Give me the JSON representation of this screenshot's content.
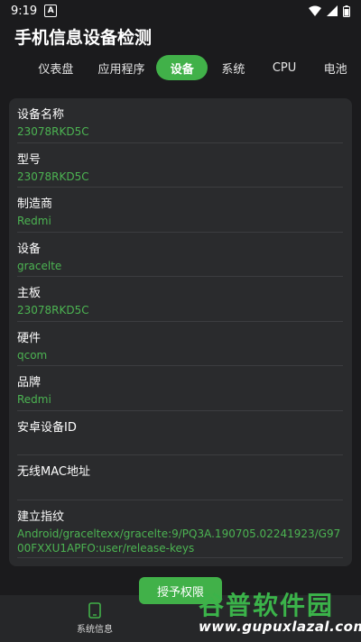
{
  "status_bar": {
    "time": "9:19",
    "notification_glyph": "A"
  },
  "app": {
    "title": "手机信息设备检测"
  },
  "tabs": [
    {
      "label": "仪表盘",
      "active": false
    },
    {
      "label": "应用程序",
      "active": false
    },
    {
      "label": "设备",
      "active": true
    },
    {
      "label": "系统",
      "active": false
    },
    {
      "label": "CPU",
      "active": false
    },
    {
      "label": "电池",
      "active": false
    }
  ],
  "device_info": [
    {
      "label": "设备名称",
      "value": "23078RKD5C"
    },
    {
      "label": "型号",
      "value": "23078RKD5C"
    },
    {
      "label": "制造商",
      "value": "Redmi"
    },
    {
      "label": "设备",
      "value": "gracelte"
    },
    {
      "label": "主板",
      "value": "23078RKD5C"
    },
    {
      "label": "硬件",
      "value": "qcom"
    },
    {
      "label": "品牌",
      "value": "Redmi"
    },
    {
      "label": "安卓设备ID",
      "value": ""
    },
    {
      "label": "无线MAC地址",
      "value": ""
    },
    {
      "label": "建立指纹",
      "value": "Android/graceltexx/gracelte:9/PQ3A.190705.02241923/G9700FXXU1APFO:user/release-keys"
    }
  ],
  "grant_button": {
    "label": "授予权限"
  },
  "bottom_nav": {
    "item_label": "系统信息",
    "icon": "phone-icon"
  },
  "watermark": {
    "title": "谷普软件园",
    "url": "www.gupuxlazal.com"
  },
  "colors": {
    "accent": "#41b149",
    "background": "#1b1b1d",
    "card": "#2a2b2d",
    "value_text": "#4cb452"
  }
}
